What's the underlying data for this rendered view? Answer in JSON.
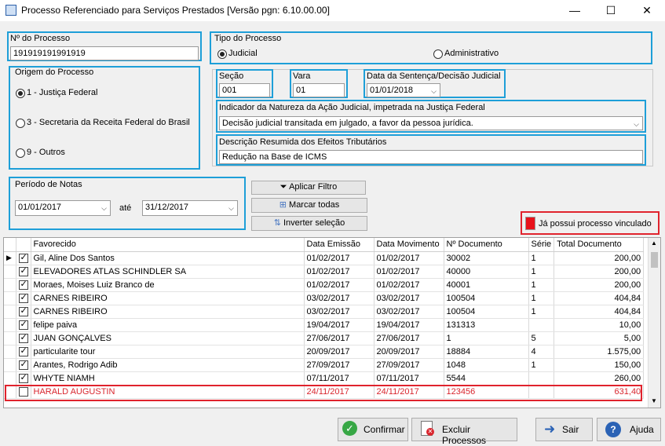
{
  "window": {
    "title": "Processo Referenciado para Serviços Prestados [Versão pgn: 6.10.00.00]"
  },
  "processo": {
    "label": "Nº do Processo",
    "value": "191919191991919"
  },
  "tipo": {
    "label": "Tipo do Processo",
    "judicial": "Judicial",
    "administrativo": "Administrativo",
    "selected": "Judicial"
  },
  "origem": {
    "label": "Origem do Processo",
    "options": [
      "1 - Justiça Federal",
      "3 - Secretaria da Receita Federal do Brasil",
      "9 - Outros"
    ],
    "selected": "1 - Justiça Federal"
  },
  "secao": {
    "label": "Seção",
    "value": "001"
  },
  "vara": {
    "label": "Vara",
    "value": "01"
  },
  "data_sentenca": {
    "label": "Data da Sentença/Decisão Judicial",
    "value": "01/01/2018"
  },
  "indicador": {
    "label": "Indicador da Natureza da Ação Judicial, impetrada na Justiça Federal",
    "value": "Decisão judicial transitada em julgado, a favor da pessoa jurídica."
  },
  "descricao": {
    "label": "Descrição Resumida dos Efeitos Tributários",
    "value": "Redução na Base de ICMS"
  },
  "periodo": {
    "label": "Período de Notas",
    "from": "01/01/2017",
    "ate": "até",
    "to": "31/12/2017"
  },
  "buttons": {
    "filtro": "Aplicar Filtro",
    "marcar": "Marcar todas",
    "inverter": "Inverter seleção",
    "ja_possui": "Já possui processo vinculado"
  },
  "grid": {
    "columns": [
      "Favorecido",
      "Data Emissão",
      "Data Movimento",
      "Nº Documento",
      "Série",
      "Total Documento"
    ],
    "rows": [
      [
        "Gil, Aline Dos Santos",
        "01/02/2017",
        "01/02/2017",
        "30002",
        "1",
        "200,00"
      ],
      [
        "ELEVADORES ATLAS SCHINDLER SA",
        "01/02/2017",
        "01/02/2017",
        "40000",
        "1",
        "200,00"
      ],
      [
        "Moraes, Moises Luiz Branco de",
        "01/02/2017",
        "01/02/2017",
        "40001",
        "1",
        "200,00"
      ],
      [
        "CARNES RIBEIRO",
        "03/02/2017",
        "03/02/2017",
        "100504",
        "1",
        "404,84"
      ],
      [
        "CARNES RIBEIRO",
        "03/02/2017",
        "03/02/2017",
        "100504",
        "1",
        "404,84"
      ],
      [
        "felipe paiva",
        "19/04/2017",
        "19/04/2017",
        "131313",
        "",
        "10,00"
      ],
      [
        "JUAN GONÇALVES",
        "27/06/2017",
        "27/06/2017",
        "1",
        "5",
        "5,00"
      ],
      [
        "particularite tour",
        "20/09/2017",
        "20/09/2017",
        "18884",
        "4",
        "1.575,00"
      ],
      [
        "Arantes, Rodrigo Adib",
        "27/09/2017",
        "27/09/2017",
        "1048",
        "1",
        "150,00"
      ],
      [
        "WHYTE NIAMH",
        "07/11/2017",
        "07/11/2017",
        "5544",
        "",
        "260,00"
      ],
      [
        "HARALD AUGUSTIN",
        "24/11/2017",
        "24/11/2017",
        "123456",
        "",
        "631,40"
      ]
    ],
    "checked": [
      true,
      true,
      true,
      true,
      true,
      true,
      true,
      true,
      true,
      true,
      false
    ]
  },
  "footer": {
    "confirmar": "Confirmar",
    "excluir": "Excluir Processos",
    "sair": "Sair",
    "ajuda": "Ajuda"
  }
}
